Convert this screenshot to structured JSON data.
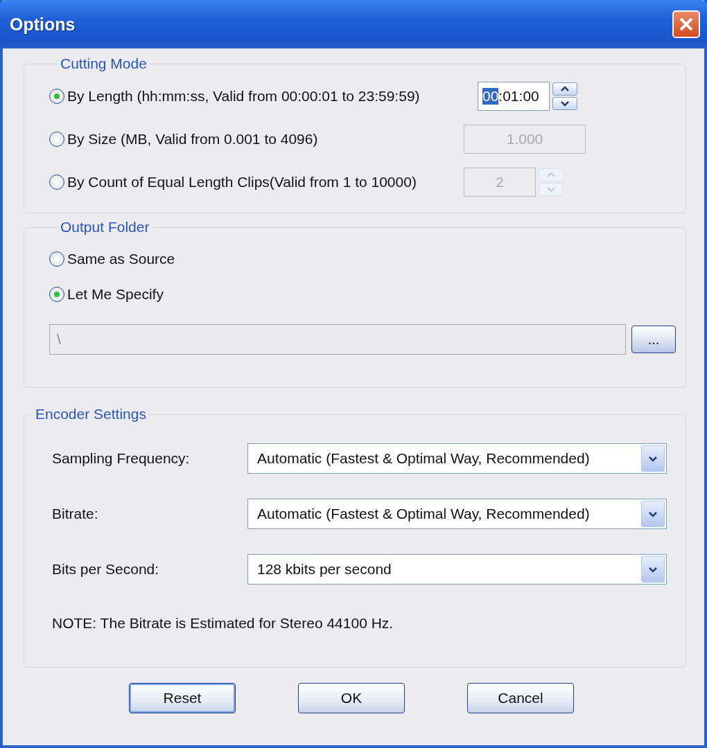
{
  "window": {
    "title": "Options"
  },
  "cutting_mode": {
    "title": "Cutting Mode",
    "options": [
      {
        "label": "By Length (hh:mm:ss, Valid from 00:00:01 to 23:59:59)",
        "selected": true,
        "field": {
          "value_parts": [
            {
              "text": "00",
              "highlighted": true
            },
            {
              "text": ":01:00",
              "highlighted": false
            }
          ],
          "disabled": false,
          "spinner": true
        }
      },
      {
        "label": "By Size (MB, Valid from 0.001 to 4096)",
        "selected": false,
        "field": {
          "value_parts": [
            {
              "text": "1.000",
              "highlighted": false
            }
          ],
          "disabled": true,
          "spinner": false
        }
      },
      {
        "label": "By Count of Equal Length Clips(Valid from 1 to 10000)",
        "selected": false,
        "field": {
          "value_parts": [
            {
              "text": "2",
              "highlighted": false
            }
          ],
          "disabled": true,
          "spinner": true
        }
      }
    ]
  },
  "output_folder": {
    "title": "Output Folder",
    "options": [
      {
        "label": "Same as Source",
        "selected": false
      },
      {
        "label": "Let Me Specify",
        "selected": true
      }
    ],
    "path": "\\",
    "browse_button": "..."
  },
  "encoder_settings": {
    "title": "Encoder Settings",
    "rows": [
      {
        "label": "Sampling Frequency:",
        "value": "Automatic (Fastest & Optimal Way, Recommended)"
      },
      {
        "label": "Bitrate:",
        "value": "Automatic (Fastest & Optimal Way, Recommended)"
      },
      {
        "label": "Bits per Second:",
        "value": "128 kbits per second"
      }
    ],
    "note": "NOTE: The Bitrate is Estimated  for Stereo 44100 Hz."
  },
  "buttons": [
    "Reset",
    "OK",
    "Cancel"
  ]
}
